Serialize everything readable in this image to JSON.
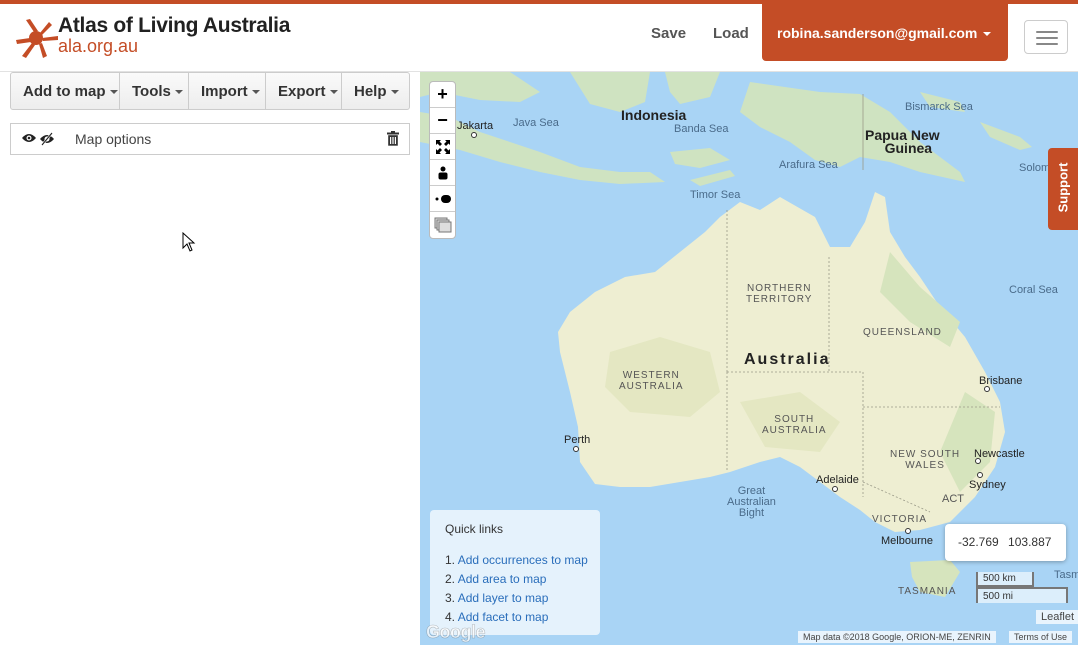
{
  "header": {
    "brand_title": "Atlas of Living Australia",
    "brand_sub": "ala.org.au",
    "save_label": "Save",
    "load_label": "Load",
    "user_email": "robina.sanderson@gmail.com",
    "accent_color": "#c44d26"
  },
  "toolbar": {
    "items": [
      {
        "label": "Add to map"
      },
      {
        "label": "Tools"
      },
      {
        "label": "Import"
      },
      {
        "label": "Export"
      },
      {
        "label": "Help"
      }
    ]
  },
  "layers": {
    "items": [
      {
        "label": "Map options",
        "icons": [
          "eye-icon",
          "eye-slash-icon",
          "trash-icon"
        ]
      }
    ]
  },
  "map": {
    "controls": [
      "+",
      "−"
    ],
    "control_icons": [
      "zoom-in-icon",
      "zoom-out-icon",
      "fullscreen-icon",
      "person-pin-icon",
      "draw-marker-icon",
      "layers-icon"
    ],
    "labels": {
      "indonesia": "Indonesia",
      "png": "Papua New Guinea",
      "png_line1": "Papua New",
      "png_line2": "Guinea",
      "australia": "Australia",
      "java_sea": "Java Sea",
      "banda_sea": "Banda Sea",
      "bismarck_sea": "Bismarck Sea",
      "arafura_sea": "Arafura Sea",
      "timor_sea": "Timor Sea",
      "solomon_sea": "Solomon Se",
      "coral_sea": "Coral Sea",
      "great_bight_1": "Great",
      "great_bight_2": "Australian",
      "great_bight_3": "Bight",
      "tasman": "Tasm",
      "jakarta": "Jakarta",
      "perth": "Perth",
      "adelaide": "Adelaide",
      "melbourne": "Melbourne",
      "sydney": "Sydney",
      "brisbane": "Brisbane",
      "newcastle": "Newcastle",
      "act": "ACT",
      "nt_1": "NORTHERN",
      "nt_2": "TERRITORY",
      "qld": "QUEENSLAND",
      "wa_1": "WESTERN",
      "wa_2": "AUSTRALIA",
      "sa_1": "SOUTH",
      "sa_2": "AUSTRALIA",
      "nsw_1": "NEW SOUTH",
      "nsw_2": "WALES",
      "vic": "VICTORIA",
      "tas": "TASMANIA"
    },
    "coords": {
      "lat": "-32.769",
      "lon": "103.887"
    },
    "scale_km": "500 km",
    "scale_mi": "500 mi",
    "leaflet": "Leaflet",
    "map_data": "Map data ©2018 Google, ORION-ME, ZENRIN",
    "terms": "Terms of Use",
    "google": "Google"
  },
  "quick_links": {
    "title": "Quick links",
    "items": [
      {
        "num": "1.",
        "label": "Add occurrences to map"
      },
      {
        "num": "2.",
        "label": "Add area to map"
      },
      {
        "num": "3.",
        "label": "Add layer to map"
      },
      {
        "num": "4.",
        "label": "Add facet to map"
      }
    ]
  },
  "support": {
    "label": "Support"
  }
}
